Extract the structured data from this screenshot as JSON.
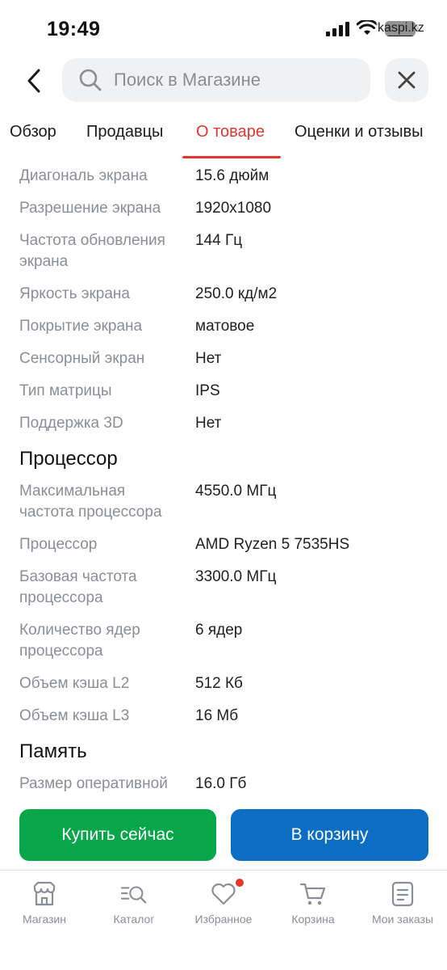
{
  "status_bar": {
    "time": "19:49",
    "watermark": "kaspi.kz"
  },
  "header": {
    "search_placeholder": "Поиск в Магазине"
  },
  "tabs": [
    {
      "label": "Обзор",
      "active": false
    },
    {
      "label": "Продавцы",
      "active": false
    },
    {
      "label": "О товаре",
      "active": true
    },
    {
      "label": "Оценки и отзывы",
      "active": false
    }
  ],
  "specs": {
    "screen": [
      {
        "label": "Диагональ экрана",
        "value": "15.6 дюйм"
      },
      {
        "label": "Разрешение экрана",
        "value": "1920x1080"
      },
      {
        "label": "Частота обновления экрана",
        "value": "144 Гц"
      },
      {
        "label": "Яркость экрана",
        "value": "250.0 кд/м2"
      },
      {
        "label": "Покрытие экрана",
        "value": "матовое"
      },
      {
        "label": "Сенсорный экран",
        "value": "Нет"
      },
      {
        "label": "Тип матрицы",
        "value": "IPS"
      },
      {
        "label": "Поддержка 3D",
        "value": "Нет"
      }
    ],
    "processor_title": "Процессор",
    "processor": [
      {
        "label": "Максимальная частота процессора",
        "value": "4550.0 МГц"
      },
      {
        "label": "Процессор",
        "value": "AMD Ryzen 5 7535HS"
      },
      {
        "label": "Базовая частота процессора",
        "value": "3300.0 МГц"
      },
      {
        "label": "Количество ядер процессора",
        "value": "6 ядер"
      },
      {
        "label": "Объем кэша L2",
        "value": "512 Кб"
      },
      {
        "label": "Объем кэша L3",
        "value": "16 Мб"
      }
    ],
    "memory_title": "Память",
    "memory": [
      {
        "label": "Размер оперативной",
        "value": "16.0 Гб"
      }
    ]
  },
  "actions": {
    "buy_label": "Купить сейчас",
    "cart_label": "В корзину"
  },
  "bottom_nav": [
    {
      "label": "Магазин",
      "icon": "store-icon"
    },
    {
      "label": "Каталог",
      "icon": "catalog-search-icon"
    },
    {
      "label": "Избранное",
      "icon": "heart-icon",
      "badge_dot": true
    },
    {
      "label": "Корзина",
      "icon": "cart-icon"
    },
    {
      "label": "Мои заказы",
      "icon": "orders-icon"
    }
  ],
  "colors": {
    "accent_red": "#e4352f",
    "buy_green": "#07a648",
    "cart_blue": "#0b6ec4",
    "label_gray": "#8b8e94"
  }
}
